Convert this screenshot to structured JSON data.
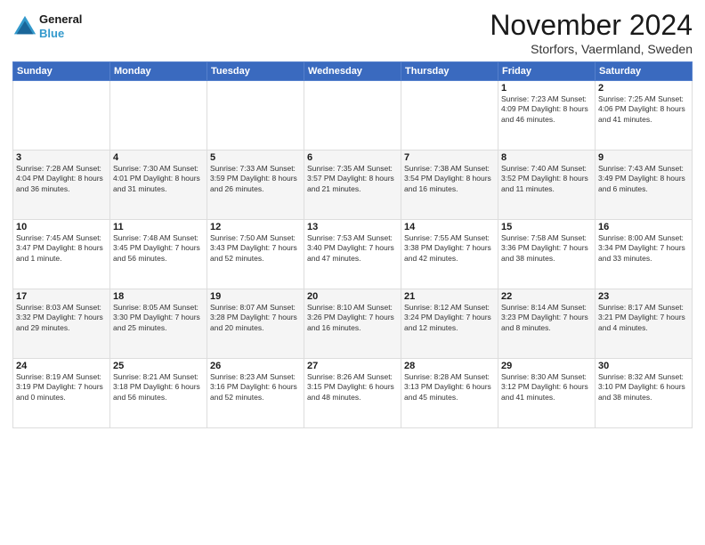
{
  "logo": {
    "text_general": "General",
    "text_blue": "Blue"
  },
  "header": {
    "month": "November 2024",
    "location": "Storfors, Vaermland, Sweden"
  },
  "weekdays": [
    "Sunday",
    "Monday",
    "Tuesday",
    "Wednesday",
    "Thursday",
    "Friday",
    "Saturday"
  ],
  "weeks": [
    [
      {
        "day": "",
        "info": ""
      },
      {
        "day": "",
        "info": ""
      },
      {
        "day": "",
        "info": ""
      },
      {
        "day": "",
        "info": ""
      },
      {
        "day": "",
        "info": ""
      },
      {
        "day": "1",
        "info": "Sunrise: 7:23 AM\nSunset: 4:09 PM\nDaylight: 8 hours and 46 minutes."
      },
      {
        "day": "2",
        "info": "Sunrise: 7:25 AM\nSunset: 4:06 PM\nDaylight: 8 hours and 41 minutes."
      }
    ],
    [
      {
        "day": "3",
        "info": "Sunrise: 7:28 AM\nSunset: 4:04 PM\nDaylight: 8 hours and 36 minutes."
      },
      {
        "day": "4",
        "info": "Sunrise: 7:30 AM\nSunset: 4:01 PM\nDaylight: 8 hours and 31 minutes."
      },
      {
        "day": "5",
        "info": "Sunrise: 7:33 AM\nSunset: 3:59 PM\nDaylight: 8 hours and 26 minutes."
      },
      {
        "day": "6",
        "info": "Sunrise: 7:35 AM\nSunset: 3:57 PM\nDaylight: 8 hours and 21 minutes."
      },
      {
        "day": "7",
        "info": "Sunrise: 7:38 AM\nSunset: 3:54 PM\nDaylight: 8 hours and 16 minutes."
      },
      {
        "day": "8",
        "info": "Sunrise: 7:40 AM\nSunset: 3:52 PM\nDaylight: 8 hours and 11 minutes."
      },
      {
        "day": "9",
        "info": "Sunrise: 7:43 AM\nSunset: 3:49 PM\nDaylight: 8 hours and 6 minutes."
      }
    ],
    [
      {
        "day": "10",
        "info": "Sunrise: 7:45 AM\nSunset: 3:47 PM\nDaylight: 8 hours and 1 minute."
      },
      {
        "day": "11",
        "info": "Sunrise: 7:48 AM\nSunset: 3:45 PM\nDaylight: 7 hours and 56 minutes."
      },
      {
        "day": "12",
        "info": "Sunrise: 7:50 AM\nSunset: 3:43 PM\nDaylight: 7 hours and 52 minutes."
      },
      {
        "day": "13",
        "info": "Sunrise: 7:53 AM\nSunset: 3:40 PM\nDaylight: 7 hours and 47 minutes."
      },
      {
        "day": "14",
        "info": "Sunrise: 7:55 AM\nSunset: 3:38 PM\nDaylight: 7 hours and 42 minutes."
      },
      {
        "day": "15",
        "info": "Sunrise: 7:58 AM\nSunset: 3:36 PM\nDaylight: 7 hours and 38 minutes."
      },
      {
        "day": "16",
        "info": "Sunrise: 8:00 AM\nSunset: 3:34 PM\nDaylight: 7 hours and 33 minutes."
      }
    ],
    [
      {
        "day": "17",
        "info": "Sunrise: 8:03 AM\nSunset: 3:32 PM\nDaylight: 7 hours and 29 minutes."
      },
      {
        "day": "18",
        "info": "Sunrise: 8:05 AM\nSunset: 3:30 PM\nDaylight: 7 hours and 25 minutes."
      },
      {
        "day": "19",
        "info": "Sunrise: 8:07 AM\nSunset: 3:28 PM\nDaylight: 7 hours and 20 minutes."
      },
      {
        "day": "20",
        "info": "Sunrise: 8:10 AM\nSunset: 3:26 PM\nDaylight: 7 hours and 16 minutes."
      },
      {
        "day": "21",
        "info": "Sunrise: 8:12 AM\nSunset: 3:24 PM\nDaylight: 7 hours and 12 minutes."
      },
      {
        "day": "22",
        "info": "Sunrise: 8:14 AM\nSunset: 3:23 PM\nDaylight: 7 hours and 8 minutes."
      },
      {
        "day": "23",
        "info": "Sunrise: 8:17 AM\nSunset: 3:21 PM\nDaylight: 7 hours and 4 minutes."
      }
    ],
    [
      {
        "day": "24",
        "info": "Sunrise: 8:19 AM\nSunset: 3:19 PM\nDaylight: 7 hours and 0 minutes."
      },
      {
        "day": "25",
        "info": "Sunrise: 8:21 AM\nSunset: 3:18 PM\nDaylight: 6 hours and 56 minutes."
      },
      {
        "day": "26",
        "info": "Sunrise: 8:23 AM\nSunset: 3:16 PM\nDaylight: 6 hours and 52 minutes."
      },
      {
        "day": "27",
        "info": "Sunrise: 8:26 AM\nSunset: 3:15 PM\nDaylight: 6 hours and 48 minutes."
      },
      {
        "day": "28",
        "info": "Sunrise: 8:28 AM\nSunset: 3:13 PM\nDaylight: 6 hours and 45 minutes."
      },
      {
        "day": "29",
        "info": "Sunrise: 8:30 AM\nSunset: 3:12 PM\nDaylight: 6 hours and 41 minutes."
      },
      {
        "day": "30",
        "info": "Sunrise: 8:32 AM\nSunset: 3:10 PM\nDaylight: 6 hours and 38 minutes."
      }
    ]
  ]
}
